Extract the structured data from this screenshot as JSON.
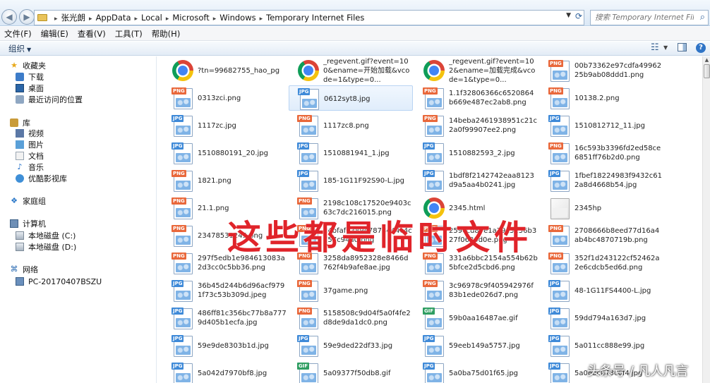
{
  "window": {
    "breadcrumbs": [
      "张光朗",
      "AppData",
      "Local",
      "Microsoft",
      "Windows",
      "Temporary Internet Files"
    ],
    "search_placeholder": "搜索 Temporary Internet Files"
  },
  "menu": [
    "文件(F)",
    "编辑(E)",
    "查看(V)",
    "工具(T)",
    "帮助(H)"
  ],
  "toolbar": {
    "organize": "组织"
  },
  "nav": {
    "favorites": {
      "label": "收藏夹",
      "items": [
        "下载",
        "桌面",
        "最近访问的位置"
      ]
    },
    "libraries": {
      "label": "库",
      "items": [
        "视频",
        "图片",
        "文档",
        "音乐",
        "优酷影视库"
      ]
    },
    "homegroup": "家庭组",
    "computer": {
      "label": "计算机",
      "items": [
        "本地磁盘 (C:)",
        "本地磁盘 (D:)"
      ]
    },
    "network": {
      "label": "网络",
      "items": [
        "PC-20170407BSZU"
      ]
    }
  },
  "files": [
    {
      "name": "?tn=99682755_hao_pg",
      "icon": "chrome"
    },
    {
      "name": "_regevent.gif?event=100&ename=开始加载&vcode=1&type=0...",
      "icon": "chrome"
    },
    {
      "name": "_regevent.gif?event=102&ename=加载完成&vcode=1&type=0...",
      "icon": "chrome"
    },
    {
      "name": "00b73362e97cdfa4996225b9ab08ddd1.png",
      "icon": "png"
    },
    {
      "name": "0313zci.png",
      "icon": "png"
    },
    {
      "name": "0612syt8.jpg",
      "icon": "jpg"
    },
    {
      "name": "1.1f32806366c6520864b669e487ec2ab8.png",
      "icon": "png"
    },
    {
      "name": "10138.2.png",
      "icon": "png"
    },
    {
      "name": "1117zc.jpg",
      "icon": "jpg"
    },
    {
      "name": "1117zc8.png",
      "icon": "png"
    },
    {
      "name": "14beba2461938951c21c2a0f99907ee2.png",
      "icon": "png"
    },
    {
      "name": "1510812712_11.jpg",
      "icon": "jpg"
    },
    {
      "name": "1510880191_20.jpg",
      "icon": "jpg"
    },
    {
      "name": "1510881941_1.jpg",
      "icon": "jpg"
    },
    {
      "name": "1510882593_2.jpg",
      "icon": "jpg"
    },
    {
      "name": "16c593b3396fd2ed58ce6851ff76b2d0.png",
      "icon": "png"
    },
    {
      "name": "1821.png",
      "icon": "png"
    },
    {
      "name": "185-1G11F92S90-L.jpg",
      "icon": "jpg"
    },
    {
      "name": "1bdf8f2142742eaa8123d9a5aa4b0241.jpg",
      "icon": "jpg"
    },
    {
      "name": "1fbef18224983f9432c612a8d4668b54.jpg",
      "icon": "jpg"
    },
    {
      "name": "21.1.png",
      "icon": "png"
    },
    {
      "name": "2198c108c17520e9403c63c7dc216015.png",
      "icon": "png"
    },
    {
      "name": "2345.html",
      "icon": "chrome"
    },
    {
      "name": "2345hp",
      "icon": "plain"
    },
    {
      "name": "23478531245.png",
      "icon": "png"
    },
    {
      "name": "24bfaf0389e7878444c4c757c94d0.png",
      "icon": "png"
    },
    {
      "name": "259ccd87e1a79c3156b327f0630d0e.png",
      "icon": "png"
    },
    {
      "name": "2708666b8eed77d16a4ab4bc4870719b.png",
      "icon": "png"
    },
    {
      "name": "297f5edb1e984613083a2d3cc0c5bb36.png",
      "icon": "png"
    },
    {
      "name": "3258da8952328e8466d762f4b9afe8ae.jpg",
      "icon": "png"
    },
    {
      "name": "331a6bbc2154a554b62b5bfce2d5cbd6.png",
      "icon": "png"
    },
    {
      "name": "352f1d243122cf52462a2e6cdcb5ed6d.png",
      "icon": "png"
    },
    {
      "name": "36b45d244b6d96acf9791f73c53b309d.jpeg",
      "icon": "jpg"
    },
    {
      "name": "37game.png",
      "icon": "png"
    },
    {
      "name": "3c96978c9f405942976f83b1ede026d7.png",
      "icon": "png"
    },
    {
      "name": "48-1G11FS4400-L.jpg",
      "icon": "jpg"
    },
    {
      "name": "486ff81c356bc77b8a7779d405b1ecfa.jpg",
      "icon": "jpg"
    },
    {
      "name": "5158508c9d04f5a0f4fe2d8de9da1dc0.png",
      "icon": "png"
    },
    {
      "name": "59b0aa16487ae.gif",
      "icon": "gif"
    },
    {
      "name": "59dd794a163d7.jpg",
      "icon": "jpg"
    },
    {
      "name": "59e9de8303b1d.jpg",
      "icon": "jpg"
    },
    {
      "name": "59e9ded22df33.jpg",
      "icon": "jpg"
    },
    {
      "name": "59eeb149a5757.jpg",
      "icon": "jpg"
    },
    {
      "name": "5a011cc888e99.jpg",
      "icon": "jpg"
    },
    {
      "name": "5a042d7970bf8.jpg",
      "icon": "jpg"
    },
    {
      "name": "5a09377f50db8.gif",
      "icon": "gif"
    },
    {
      "name": "5a0ba75d01f65.jpg",
      "icon": "jpg"
    },
    {
      "name": "5a0e8c073c6f4.jpg",
      "icon": "jpg"
    }
  ],
  "overlay_text": "这些都是临时文件",
  "watermark": "头条号 / 凡人凡言"
}
